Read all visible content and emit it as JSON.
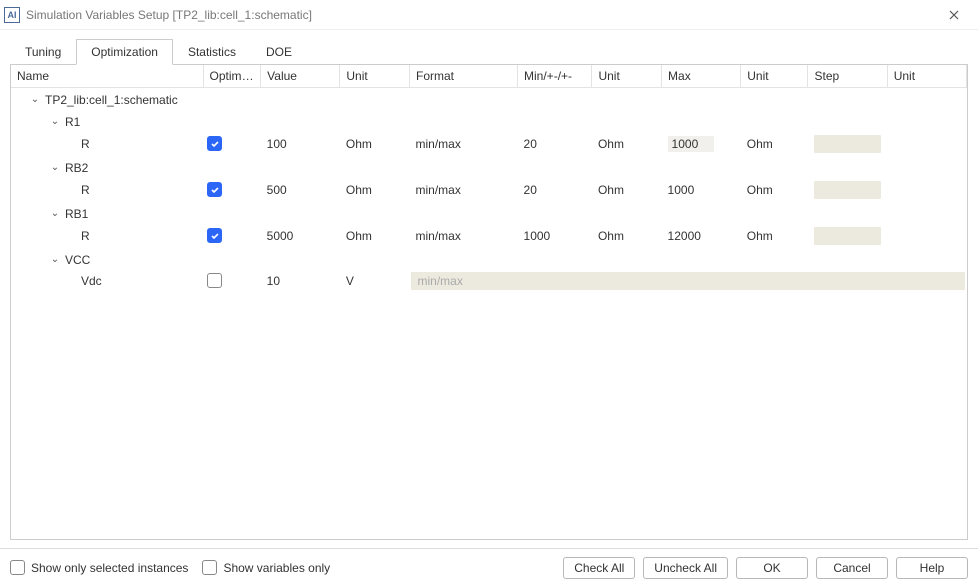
{
  "window": {
    "title": "Simulation Variables Setup [TP2_lib:cell_1:schematic]"
  },
  "tabs": {
    "items": [
      {
        "label": "Tuning"
      },
      {
        "label": "Optimization"
      },
      {
        "label": "Statistics"
      },
      {
        "label": "DOE"
      }
    ],
    "active_index": 1
  },
  "columns": {
    "name": "Name",
    "optimize": "Optimize",
    "value": "Value",
    "unit1": "Unit",
    "format": "Format",
    "min": "Min/+-/+-",
    "unit2": "Unit",
    "max": "Max",
    "unit3": "Unit",
    "step": "Step",
    "unit4": "Unit"
  },
  "tree": {
    "root": {
      "label": "TP2_lib:cell_1:schematic"
    },
    "groups": [
      {
        "label": "R1",
        "rows": [
          {
            "name": "R",
            "checked": true,
            "value": "100",
            "unit1": "Ohm",
            "format": "min/max",
            "min": "20",
            "unit2": "Ohm",
            "max": "1000",
            "max_hl": true,
            "unit3": "Ohm",
            "step_bg": true
          }
        ]
      },
      {
        "label": "RB2",
        "rows": [
          {
            "name": "R",
            "checked": true,
            "value": "500",
            "unit1": "Ohm",
            "format": "min/max",
            "min": "20",
            "unit2": "Ohm",
            "max": "1000",
            "unit3": "Ohm",
            "step_bg": true
          }
        ]
      },
      {
        "label": "RB1",
        "rows": [
          {
            "name": "R",
            "checked": true,
            "value": "5000",
            "unit1": "Ohm",
            "format": "min/max",
            "min": "1000",
            "unit2": "Ohm",
            "max": "12000",
            "unit3": "Ohm",
            "step_bg": true
          }
        ]
      },
      {
        "label": "VCC",
        "rows": [
          {
            "name": "Vdc",
            "checked": false,
            "value": "10",
            "unit1": "V",
            "format_disabled": "min/max",
            "span_disabled": true
          }
        ]
      }
    ]
  },
  "footer": {
    "show_selected": "Show only selected instances",
    "show_variables": "Show variables only",
    "buttons": {
      "check_all": "Check All",
      "uncheck_all": "Uncheck All",
      "ok": "OK",
      "cancel": "Cancel",
      "help": "Help"
    }
  }
}
